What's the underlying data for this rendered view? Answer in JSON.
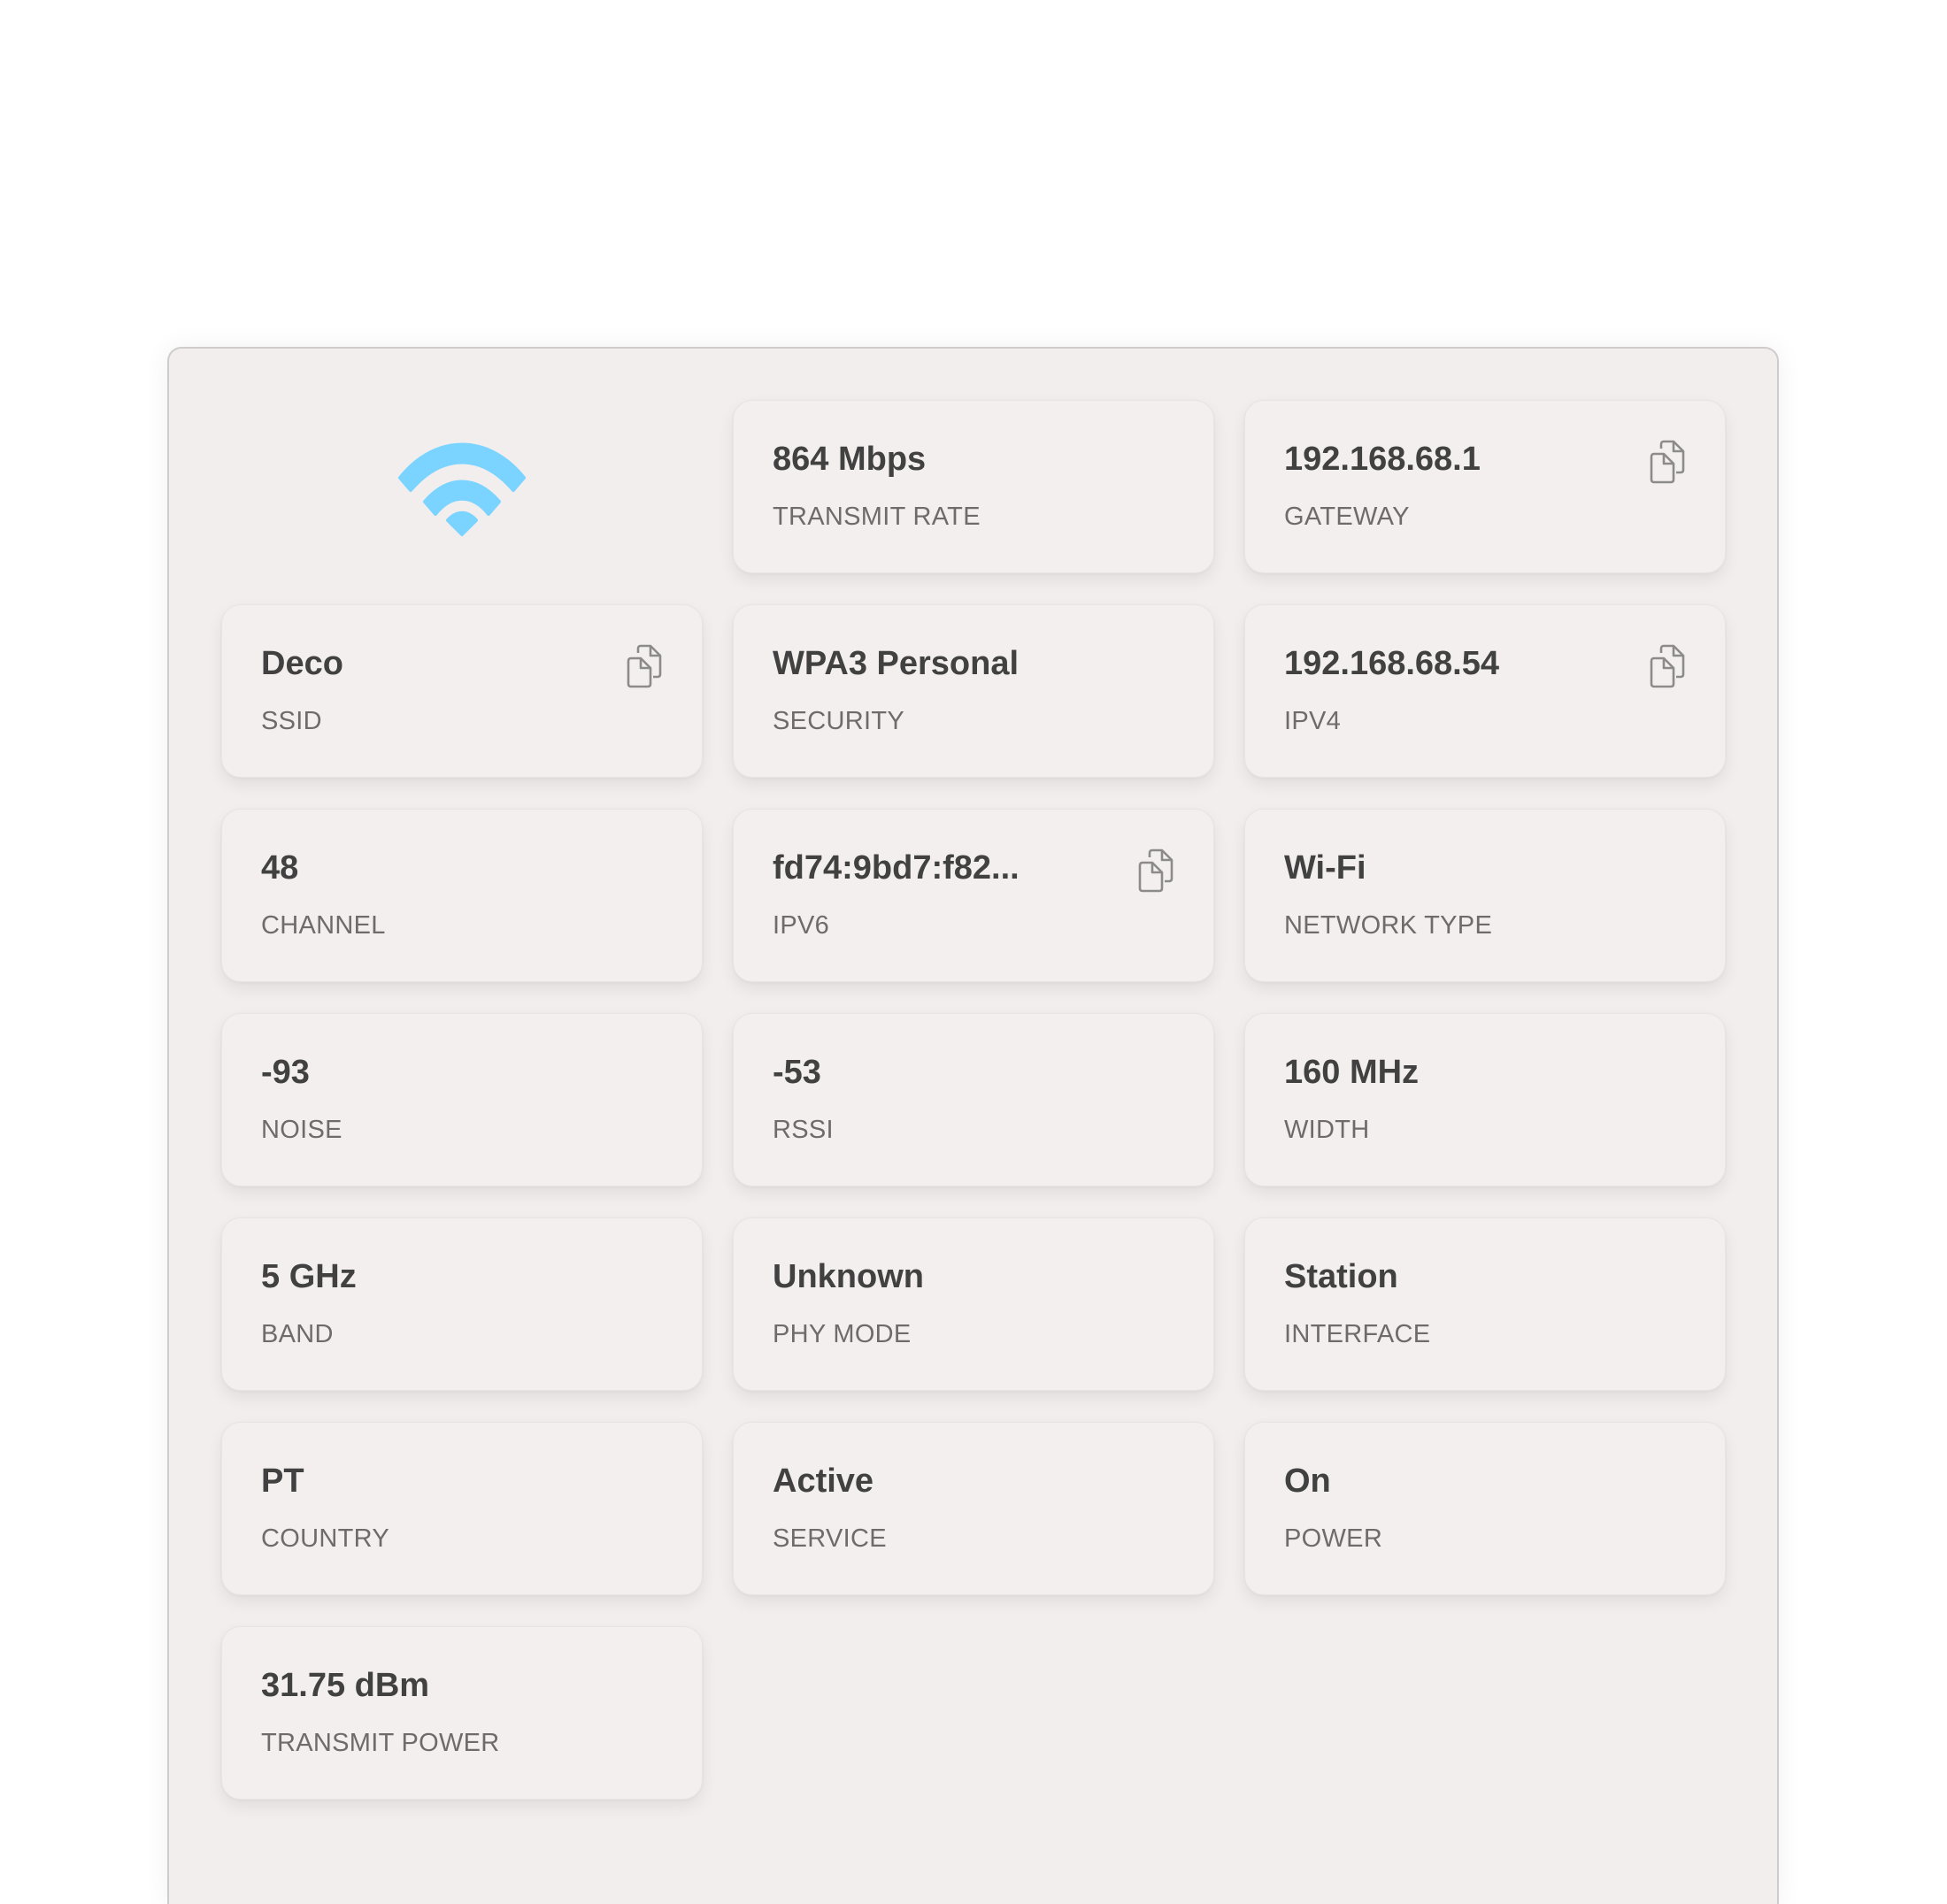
{
  "header": {
    "icon": "wifi-icon",
    "icon_color": "#7AD4FF"
  },
  "cards": {
    "transmit_rate": {
      "value": "864 Mbps",
      "label": "TRANSMIT RATE",
      "copyable": false
    },
    "gateway": {
      "value": "192.168.68.1",
      "label": "GATEWAY",
      "copyable": true
    },
    "ssid": {
      "value": "Deco",
      "label": "SSID",
      "copyable": true
    },
    "security": {
      "value": "WPA3 Personal",
      "label": "SECURITY",
      "copyable": false
    },
    "ipv4": {
      "value": "192.168.68.54",
      "label": "IPV4",
      "copyable": true
    },
    "channel": {
      "value": "48",
      "label": "CHANNEL",
      "copyable": false
    },
    "ipv6": {
      "value": "fd74:9bd7:f82...",
      "label": "IPV6",
      "copyable": true
    },
    "network_type": {
      "value": "Wi-Fi",
      "label": "NETWORK TYPE",
      "copyable": false
    },
    "noise": {
      "value": "-93",
      "label": "NOISE",
      "copyable": false
    },
    "rssi": {
      "value": "-53",
      "label": "RSSI",
      "copyable": false
    },
    "width": {
      "value": "160 MHz",
      "label": "WIDTH",
      "copyable": false
    },
    "band": {
      "value": "5 GHz",
      "label": "BAND",
      "copyable": false
    },
    "phy_mode": {
      "value": "Unknown",
      "label": "PHY MODE",
      "copyable": false
    },
    "interface": {
      "value": "Station",
      "label": "INTERFACE",
      "copyable": false
    },
    "country": {
      "value": "PT",
      "label": "COUNTRY",
      "copyable": false
    },
    "service": {
      "value": "Active",
      "label": "SERVICE",
      "copyable": false
    },
    "power": {
      "value": "On",
      "label": "POWER",
      "copyable": false
    },
    "transmit_power": {
      "value": "31.75 dBm",
      "label": "TRANSMIT POWER",
      "copyable": false
    }
  },
  "icons": {
    "copy": "copy-icon"
  }
}
